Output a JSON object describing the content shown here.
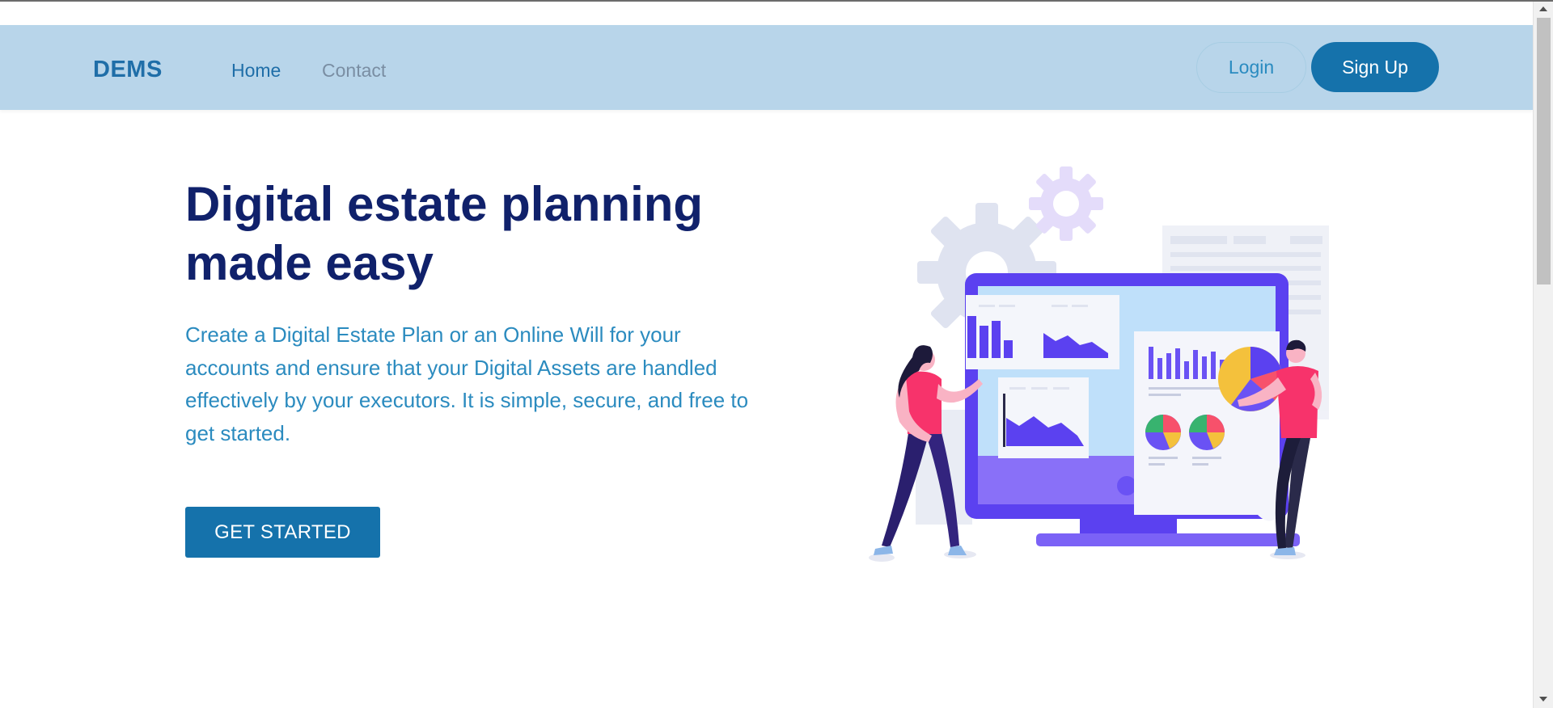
{
  "nav": {
    "brand": "DEMS",
    "links": [
      {
        "label": "Home"
      },
      {
        "label": "Contact"
      }
    ],
    "login_label": "Login",
    "signup_label": "Sign Up"
  },
  "hero": {
    "title": "Digital estate planning made easy",
    "description": "Create a Digital Estate Plan or an Online Will for your accounts and ensure that your Digital Assets are handled effectively by your executors. It is simple, secure, and free to get started.",
    "cta_label": "GET STARTED"
  },
  "colors": {
    "navbar_bg": "#b8d5ea",
    "brand": "#1f6ea8",
    "primary_button": "#1572ab",
    "title": "#10216b",
    "description": "#2b8bbf"
  },
  "illustration": {
    "name": "data-analytics-illustration"
  }
}
